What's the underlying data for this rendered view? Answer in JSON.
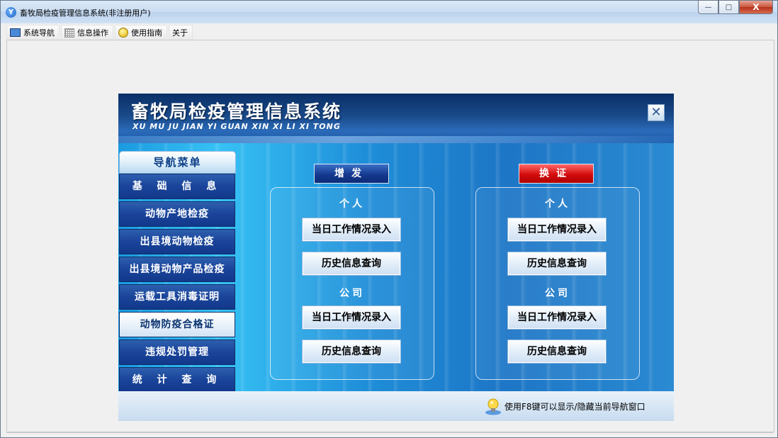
{
  "window": {
    "title": "畜牧局检疫管理信息系统(非注册用户)",
    "app_icon": "app-logo-icon",
    "controls": {
      "minimize": "—",
      "maximize": "□",
      "close": "X"
    }
  },
  "menubar": {
    "items": [
      {
        "label": "系统导航",
        "icon": "monitor-icon"
      },
      {
        "label": "信息操作",
        "icon": "grid-icon"
      },
      {
        "label": "使用指南",
        "icon": "help-bulb-icon"
      },
      {
        "label": "关于",
        "icon": ""
      }
    ]
  },
  "panel": {
    "title": "畜牧局检疫管理信息系统",
    "subtitle": "XU MU JU JIAN YI GUAN  XIN XI LI XI TONG",
    "close_glyph": "✕"
  },
  "nav": {
    "header": "导航菜单",
    "items": [
      {
        "label": "基 础 信 息",
        "active": false
      },
      {
        "label": "动物产地检疫",
        "active": false
      },
      {
        "label": "出县境动物检疫",
        "active": false
      },
      {
        "label": "出县境动物产品检疫",
        "active": false
      },
      {
        "label": "运载工具消毒证明",
        "active": false
      },
      {
        "label": "动物防疫合格证",
        "active": true
      },
      {
        "label": "违规处罚管理",
        "active": false
      },
      {
        "label": "统 计 查 询",
        "active": false
      }
    ]
  },
  "groups": {
    "issue": {
      "title": "增发",
      "color": "#14398e",
      "personal_label": "个人",
      "company_label": "公司",
      "personal_entry": "当日工作情况录入",
      "personal_history": "历史信息查询",
      "company_entry": "当日工作情况录入",
      "company_history": "历史信息查询"
    },
    "renew": {
      "title": "换证",
      "color": "#d40c0c",
      "personal_label": "个人",
      "company_label": "公司",
      "personal_entry": "当日工作情况录入",
      "personal_history": "历史信息查询",
      "company_entry": "当日工作情况录入",
      "company_history": "历史信息查询"
    }
  },
  "footer": {
    "tip": "使用F8键可以显示/隐藏当前导航窗口",
    "tip_icon": "lightbulb-icon"
  }
}
